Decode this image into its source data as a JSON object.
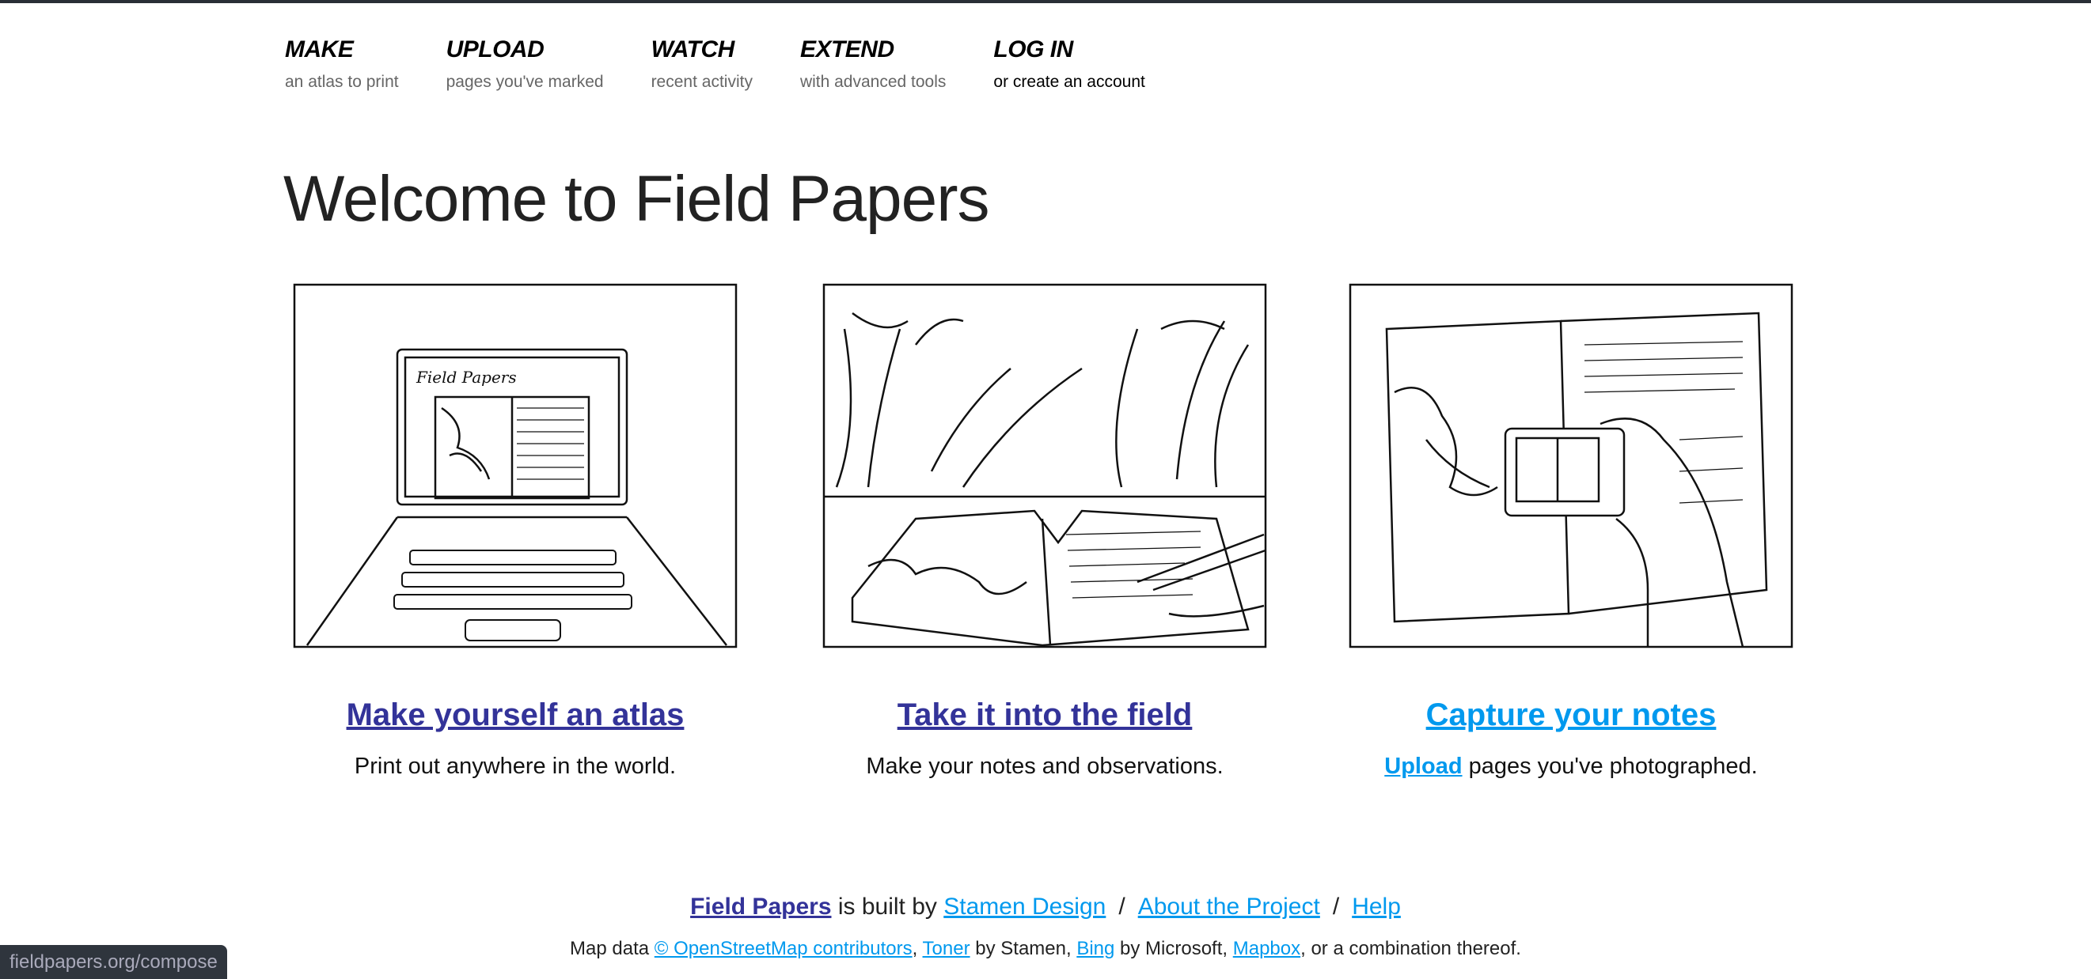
{
  "nav": [
    {
      "title": "MAKE",
      "sub": "an atlas to print"
    },
    {
      "title": "UPLOAD",
      "sub": "pages you've marked"
    },
    {
      "title": "WATCH",
      "sub": "recent activity"
    },
    {
      "title": "EXTEND",
      "sub": "with advanced tools"
    },
    {
      "title": "LOG IN",
      "sub": "or create an account"
    }
  ],
  "title": "Welcome to Field Papers",
  "columns": [
    {
      "heading": "Make yourself an atlas",
      "text": "Print out anywhere in the world.",
      "sketch_label": "Field Papers"
    },
    {
      "heading": "Take it into the field",
      "text": "Make your notes and observations."
    },
    {
      "heading": "Capture your notes",
      "link": "Upload",
      "text": " pages you've photographed."
    }
  ],
  "footer": {
    "brand": "Field Papers",
    "built_by": " is built by ",
    "stamen": "Stamen Design",
    "sep": "/",
    "about": "About the Project",
    "help": "Help",
    "map_data": "Map data ",
    "osm": "© OpenStreetMap contributors",
    "comma1": ", ",
    "toner": "Toner",
    "by_stamen": " by Stamen, ",
    "bing": "Bing",
    "by_ms": " by Microsoft, ",
    "mapbox": "Mapbox",
    "rest": ", or a combination thereof."
  },
  "status_url": "fieldpapers.org/compose"
}
